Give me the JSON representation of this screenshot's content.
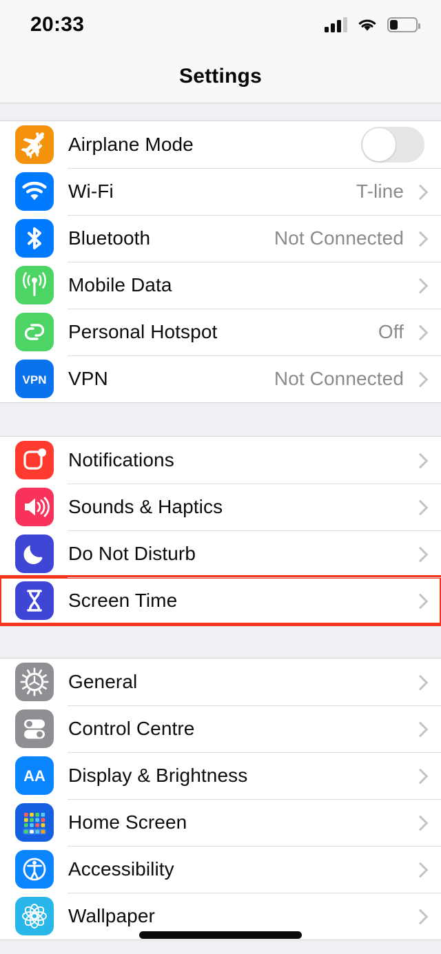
{
  "status_bar": {
    "time": "20:33",
    "signal_icon": "cellular-signal-icon",
    "signal_bars_filled": 3,
    "signal_bars_total": 4,
    "wifi_icon": "wifi-icon",
    "battery_icon": "battery-icon",
    "battery_percent": 30
  },
  "navbar": {
    "title": "Settings"
  },
  "colors": {
    "airplane": "#f5920b",
    "wifi": "#007aff",
    "bluetooth": "#007aff",
    "mobile_data": "#4cd464",
    "hotspot": "#4cd464",
    "vpn": "#0b72ee",
    "notifications": "#ff3b30",
    "sounds": "#f8325a",
    "dnd": "#3f45d4",
    "screen_time": "#3f45d4",
    "general": "#8e8e93",
    "control_centre": "#8e8e93",
    "display": "#0a84ff",
    "home_screen": "#1560e0",
    "accessibility": "#0a84ff",
    "wallpaper": "#29b6e8",
    "highlight": "#f4351b",
    "value_text": "#8a8a8e",
    "chevron": "#c2c2c7"
  },
  "groups": [
    {
      "id": "connectivity",
      "rows": [
        {
          "label": "Airplane Mode",
          "icon": "airplane-icon",
          "accessory": "toggle",
          "toggle_on": false,
          "value": ""
        },
        {
          "label": "Wi-Fi",
          "icon": "wifi-icon",
          "accessory": "chevron",
          "value": "T-line"
        },
        {
          "label": "Bluetooth",
          "icon": "bluetooth-icon",
          "accessory": "chevron",
          "value": "Not Connected"
        },
        {
          "label": "Mobile Data",
          "icon": "mobile-data-icon",
          "accessory": "chevron",
          "value": ""
        },
        {
          "label": "Personal Hotspot",
          "icon": "personal-hotspot-icon",
          "accessory": "chevron",
          "value": "Off"
        },
        {
          "label": "VPN",
          "icon": "vpn-icon",
          "accessory": "chevron",
          "value": "Not Connected"
        }
      ]
    },
    {
      "id": "alerts",
      "rows": [
        {
          "label": "Notifications",
          "icon": "notifications-icon",
          "accessory": "chevron",
          "value": ""
        },
        {
          "label": "Sounds & Haptics",
          "icon": "sounds-haptics-icon",
          "accessory": "chevron",
          "value": ""
        },
        {
          "label": "Do Not Disturb",
          "icon": "do-not-disturb-icon",
          "accessory": "chevron",
          "value": ""
        },
        {
          "label": "Screen Time",
          "icon": "screen-time-icon",
          "accessory": "chevron",
          "value": "",
          "highlighted": true
        }
      ]
    },
    {
      "id": "system",
      "rows": [
        {
          "label": "General",
          "icon": "general-gear-icon",
          "accessory": "chevron",
          "value": ""
        },
        {
          "label": "Control Centre",
          "icon": "control-centre-icon",
          "accessory": "chevron",
          "value": ""
        },
        {
          "label": "Display & Brightness",
          "icon": "display-brightness-icon",
          "accessory": "chevron",
          "value": ""
        },
        {
          "label": "Home Screen",
          "icon": "home-screen-icon",
          "accessory": "chevron",
          "value": ""
        },
        {
          "label": "Accessibility",
          "icon": "accessibility-icon",
          "accessory": "chevron",
          "value": ""
        },
        {
          "label": "Wallpaper",
          "icon": "wallpaper-icon",
          "accessory": "chevron",
          "value": ""
        }
      ]
    }
  ],
  "home_indicator": "home-indicator"
}
